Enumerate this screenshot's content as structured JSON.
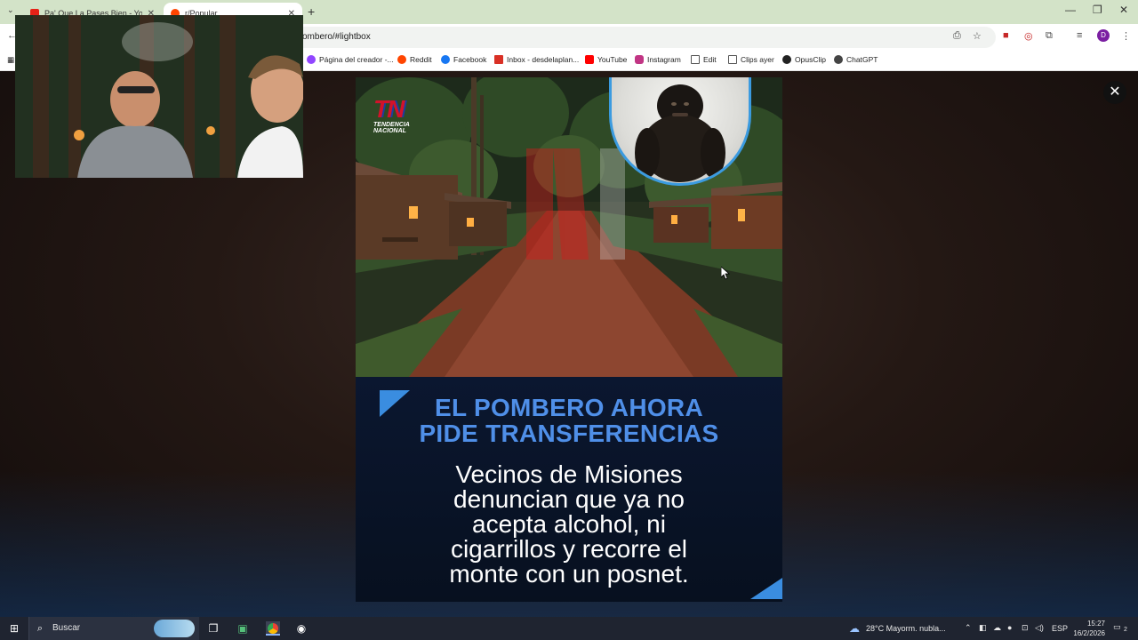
{
  "browser": {
    "tabs": [
      {
        "label": "Pa' Que La Pases Bien - YouTube",
        "favicon_color": "#e62117"
      },
      {
        "label": "r/Popular",
        "favicon_color": "#ff4500"
      }
    ],
    "url": "ombero/#lightbox",
    "new_tab_glyph": "+",
    "window_controls": [
      "—",
      "❐",
      "✕"
    ]
  },
  "bookmarks": [
    {
      "label": "Página del creador -...",
      "icon": "twitch-icon",
      "color": "#9146ff"
    },
    {
      "label": "Reddit",
      "icon": "reddit-icon",
      "color": "#ff4500"
    },
    {
      "label": "Facebook",
      "icon": "facebook-icon",
      "color": "#1877f2"
    },
    {
      "label": "Inbox - desdelaplan...",
      "icon": "gmail-icon",
      "color": "#d93025"
    },
    {
      "label": "YouTube",
      "icon": "youtube-icon",
      "color": "#ff0000"
    },
    {
      "label": "Instagram",
      "icon": "instagram-icon",
      "color": "#c13584"
    },
    {
      "label": "Edit",
      "icon": "folder-icon",
      "color": "#555555"
    },
    {
      "label": "Clips ayer",
      "icon": "folder-icon",
      "color": "#555555"
    },
    {
      "label": "OpusClip",
      "icon": "opusclip-icon",
      "color": "#222222"
    },
    {
      "label": "ChatGPT",
      "icon": "chatgpt-icon",
      "color": "#444444"
    }
  ],
  "post": {
    "logo": {
      "mark": "TN",
      "sub_line1": "TENDENCIA",
      "sub_line2": "NACIONAL"
    },
    "headline_line1": "EL POMBERO AHORA",
    "headline_line2": "PIDE TRANSFERENCIAS",
    "body_lines": [
      "Vecinos de Misiones",
      "denuncian que ya no",
      "acepta alcohol, ni",
      "cigarrillos y recorre el",
      "monte con un posnet."
    ],
    "accent_color": "#3a8de0"
  },
  "lightbox": {
    "close_glyph": "✕"
  },
  "taskbar": {
    "search_label": "Buscar",
    "weather": "28°C  Mayorm. nubla...",
    "language": "ESP",
    "time": "15:27",
    "date": "16/2/2026",
    "notifications": "2"
  }
}
